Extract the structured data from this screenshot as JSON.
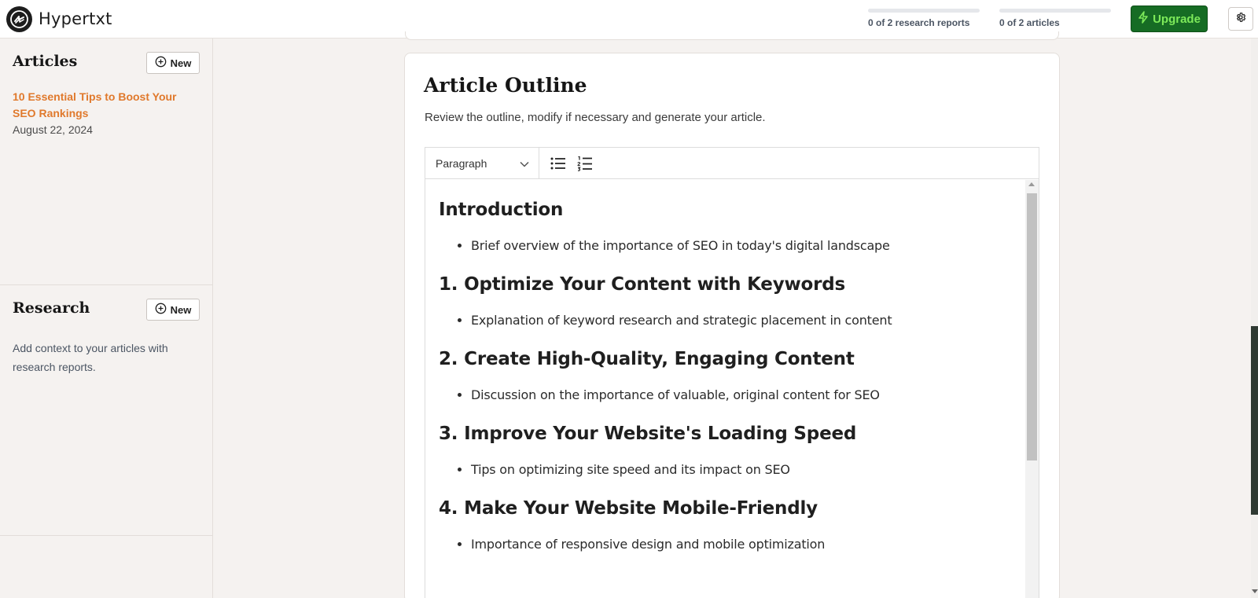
{
  "header": {
    "app_name": "Hypertxt",
    "usage": [
      {
        "label": "0 of 2 research reports",
        "progress": 0
      },
      {
        "label": "0 of 2 articles",
        "progress": 0
      }
    ],
    "upgrade_label": "Upgrade",
    "icons": {
      "logo": "hypertxt-logo-icon",
      "upgrade": "lightning-icon",
      "settings": "gear-icon"
    }
  },
  "sidebar": {
    "articles": {
      "title": "Articles",
      "new_label": "New",
      "items": [
        {
          "title": "10 Essential Tips to Boost Your SEO Rankings",
          "date": "August 22, 2024"
        }
      ]
    },
    "research": {
      "title": "Research",
      "new_label": "New",
      "description": "Add context to your articles with research reports."
    }
  },
  "main": {
    "title": "Article Outline",
    "subtitle": "Review the outline, modify if necessary and generate your article.",
    "editor": {
      "block_type": "Paragraph",
      "outline": [
        {
          "heading": "Introduction",
          "points": [
            "Brief overview of the importance of SEO in today's digital landscape"
          ]
        },
        {
          "heading": "1. Optimize Your Content with Keywords",
          "points": [
            "Explanation of keyword research and strategic placement in content"
          ]
        },
        {
          "heading": "2. Create High-Quality, Engaging Content",
          "points": [
            "Discussion on the importance of valuable, original content for SEO"
          ]
        },
        {
          "heading": "3. Improve Your Website's Loading Speed",
          "points": [
            "Tips on optimizing site speed and its impact on SEO"
          ]
        },
        {
          "heading": "4. Make Your Website Mobile-Friendly",
          "points": [
            "Importance of responsive design and mobile optimization"
          ]
        }
      ]
    }
  },
  "colors": {
    "accent_orange": "#e0792c",
    "upgrade_bg": "#166c24",
    "upgrade_text": "#7dea5a"
  }
}
